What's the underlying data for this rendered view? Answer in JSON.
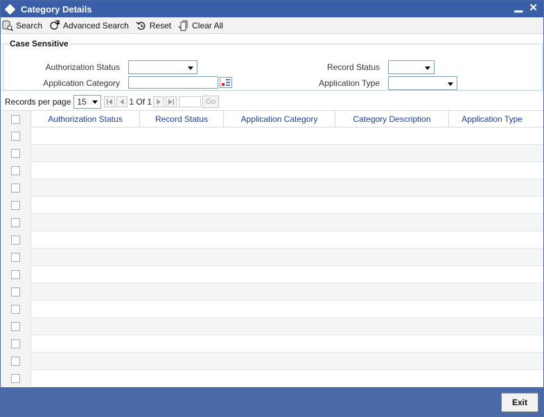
{
  "window": {
    "title": "Category Details"
  },
  "toolbar": {
    "search": "Search",
    "advanced_search": "Advanced Search",
    "reset": "Reset",
    "clear_all": "Clear All"
  },
  "criteria": {
    "legend": "Case Sensitive",
    "authorization_status_label": "Authorization Status",
    "record_status_label": "Record Status",
    "application_category_label": "Application Category",
    "application_type_label": "Application Type",
    "authorization_status_value": "",
    "record_status_value": "",
    "application_category_value": "",
    "application_type_value": ""
  },
  "pager": {
    "records_label": "Records per page",
    "records_value": "15",
    "page_info": "1 Of 1",
    "go_label": "Go"
  },
  "grid": {
    "columns": [
      "Authorization Status",
      "Record Status",
      "Application Category",
      "Category Description",
      "Application Type"
    ],
    "row_count": 15
  },
  "footer": {
    "exit": "Exit"
  },
  "colors": {
    "titlebar": "#3a5fa8",
    "footer": "#4a69a8",
    "header_text": "#1a3ea0"
  }
}
